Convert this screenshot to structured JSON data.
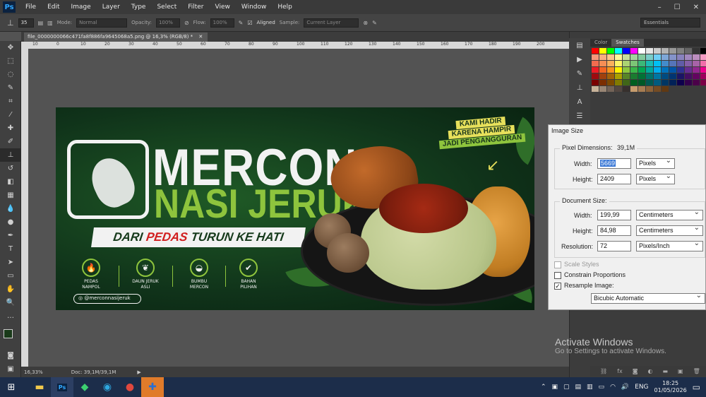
{
  "app": {
    "logo": "Ps"
  },
  "menu": [
    "File",
    "Edit",
    "Image",
    "Layer",
    "Type",
    "Select",
    "Filter",
    "View",
    "Window",
    "Help"
  ],
  "options": {
    "brush_size": "35",
    "mode_label": "Mode:",
    "mode_value": "Normal",
    "opacity_label": "Opacity:",
    "opacity_value": "100%",
    "flow_label": "Flow:",
    "flow_value": "100%",
    "aligned_label": "Aligned",
    "sample_label": "Sample:",
    "sample_value": "Current Layer",
    "workspace": "Essentials"
  },
  "document": {
    "tab_title": "file_0000000066c471fa8f886fa9645068a5.png @ 16,3% (RGB/8) *",
    "ruler_ticks": [
      "10",
      "0",
      "10",
      "20",
      "30",
      "40",
      "50",
      "60",
      "70",
      "80",
      "90",
      "100",
      "110",
      "120",
      "130",
      "140",
      "150",
      "160",
      "170",
      "180",
      "190",
      "200"
    ]
  },
  "artwork": {
    "title1": "MERCON",
    "title2": "NASI JERUK",
    "slogan_a": "DARI",
    "slogan_b": "PEDAS",
    "slogan_c": "TURUN KE HATI",
    "callout_1": "KAMI HADIR",
    "callout_2": "KARENA HAMPIR",
    "callout_3": "JADI PENGANGGURAN",
    "features": [
      {
        "l1": "PEDAS",
        "l2": "NAMPOL"
      },
      {
        "l1": "DAUN JERUK",
        "l2": "ASLI"
      },
      {
        "l1": "BUMBU",
        "l2": "MERCON"
      },
      {
        "l1": "BAHAN",
        "l2": "PILIHAN"
      }
    ],
    "instagram": "@merconnasijeruk"
  },
  "panel": {
    "tab_color": "Color",
    "tab_swatches": "Swatches"
  },
  "dialog": {
    "title": "Image Size",
    "pixel_dimensions_label": "Pixel Dimensions:",
    "pixel_dimensions_value": "39,1M",
    "width_label": "Width:",
    "width_value": "5669",
    "width_unit": "Pixels",
    "height_label": "Height:",
    "height_value": "2409",
    "height_unit": "Pixels",
    "document_size_label": "Document Size:",
    "doc_width_label": "Width:",
    "doc_width_value": "199,99",
    "doc_width_unit": "Centimeters",
    "doc_height_label": "Height:",
    "doc_height_value": "84,98",
    "doc_height_unit": "Centimeters",
    "resolution_label": "Resolution:",
    "resolution_value": "72",
    "resolution_unit": "Pixels/Inch",
    "scale_styles": "Scale Styles",
    "constrain": "Constrain Proportions",
    "resample": "Resample Image:",
    "resample_method": "Bicubic Automatic"
  },
  "status": {
    "zoom": "16,33%",
    "doc": "Doc: 39,1M/39,1M"
  },
  "watermark": {
    "line1": "Activate Windows",
    "line2": "Go to Settings to activate Windows."
  },
  "taskbar": {
    "lang": "ENG",
    "time": "18:25",
    "date": "01/05/2026"
  },
  "colors": {
    "accent_green": "#8ec43d",
    "accent_red": "#d11f1f",
    "callout_yellow": "#e7e05b"
  }
}
